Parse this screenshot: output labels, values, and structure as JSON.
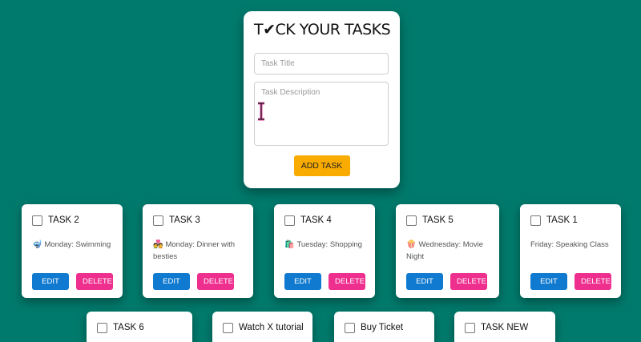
{
  "form": {
    "title": "T✔CK YOUR TASKS",
    "title_placeholder": "Task Title",
    "title_value": "",
    "description_placeholder": "Task Description",
    "description_value": "",
    "add_label": "ADD TASK"
  },
  "tasks": [
    {
      "title": "TASK 2",
      "emoji": "🤿",
      "description": "Monday: Swimming",
      "edit_label": "EDIT",
      "delete_label": "DELETE"
    },
    {
      "title": "TASK 3",
      "emoji": "💑",
      "description": "Monday: Dinner with besties",
      "edit_label": "EDIT",
      "delete_label": "DELETE"
    },
    {
      "title": "TASK 4",
      "emoji": "🛍️",
      "description": "Tuesday: Shopping",
      "edit_label": "EDIT",
      "delete_label": "DELETE"
    },
    {
      "title": "TASK 5",
      "emoji": "🍿",
      "description": "Wednesday: Movie Night",
      "edit_label": "EDIT",
      "delete_label": "DELETE"
    },
    {
      "title": "TASK 1",
      "emoji": "",
      "description": "Friday: Speaking Class",
      "edit_label": "EDIT",
      "delete_label": "DELETE"
    },
    {
      "title": "TASK 6"
    },
    {
      "title": "Watch X tutorial"
    },
    {
      "title": "Buy Ticket"
    },
    {
      "title": "TASK NEW"
    }
  ],
  "colors": {
    "background": "#007a6c",
    "add_button": "#f9ab00",
    "edit_button": "#0f7acf",
    "delete_button": "#ee2f8e"
  }
}
